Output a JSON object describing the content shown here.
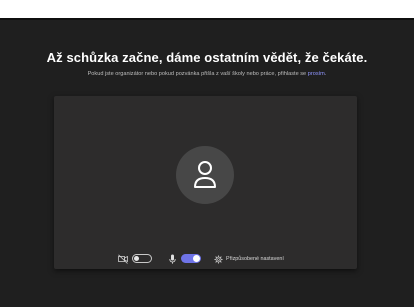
{
  "heading": "Až schůzka začne, dáme ostatním vědět, že čekáte.",
  "subtext": {
    "prefix": "Pokud jste organizátor nebo pokud pozvánka přišla z vaší školy nebo práce, přihlaste se",
    "link": "prosím",
    "suffix": "."
  },
  "controls": {
    "camera": {
      "icon": "camera-off-icon",
      "state": "off"
    },
    "microphone": {
      "icon": "microphone-icon",
      "state": "on"
    },
    "settings": {
      "icon": "gear-icon",
      "label": "Přizpůsobené nastavení"
    }
  },
  "colors": {
    "background": "#1f1f1f",
    "panel": "#2d2c2c",
    "avatar": "#474747",
    "accent": "#6f74e8",
    "link": "#8f95ff"
  }
}
